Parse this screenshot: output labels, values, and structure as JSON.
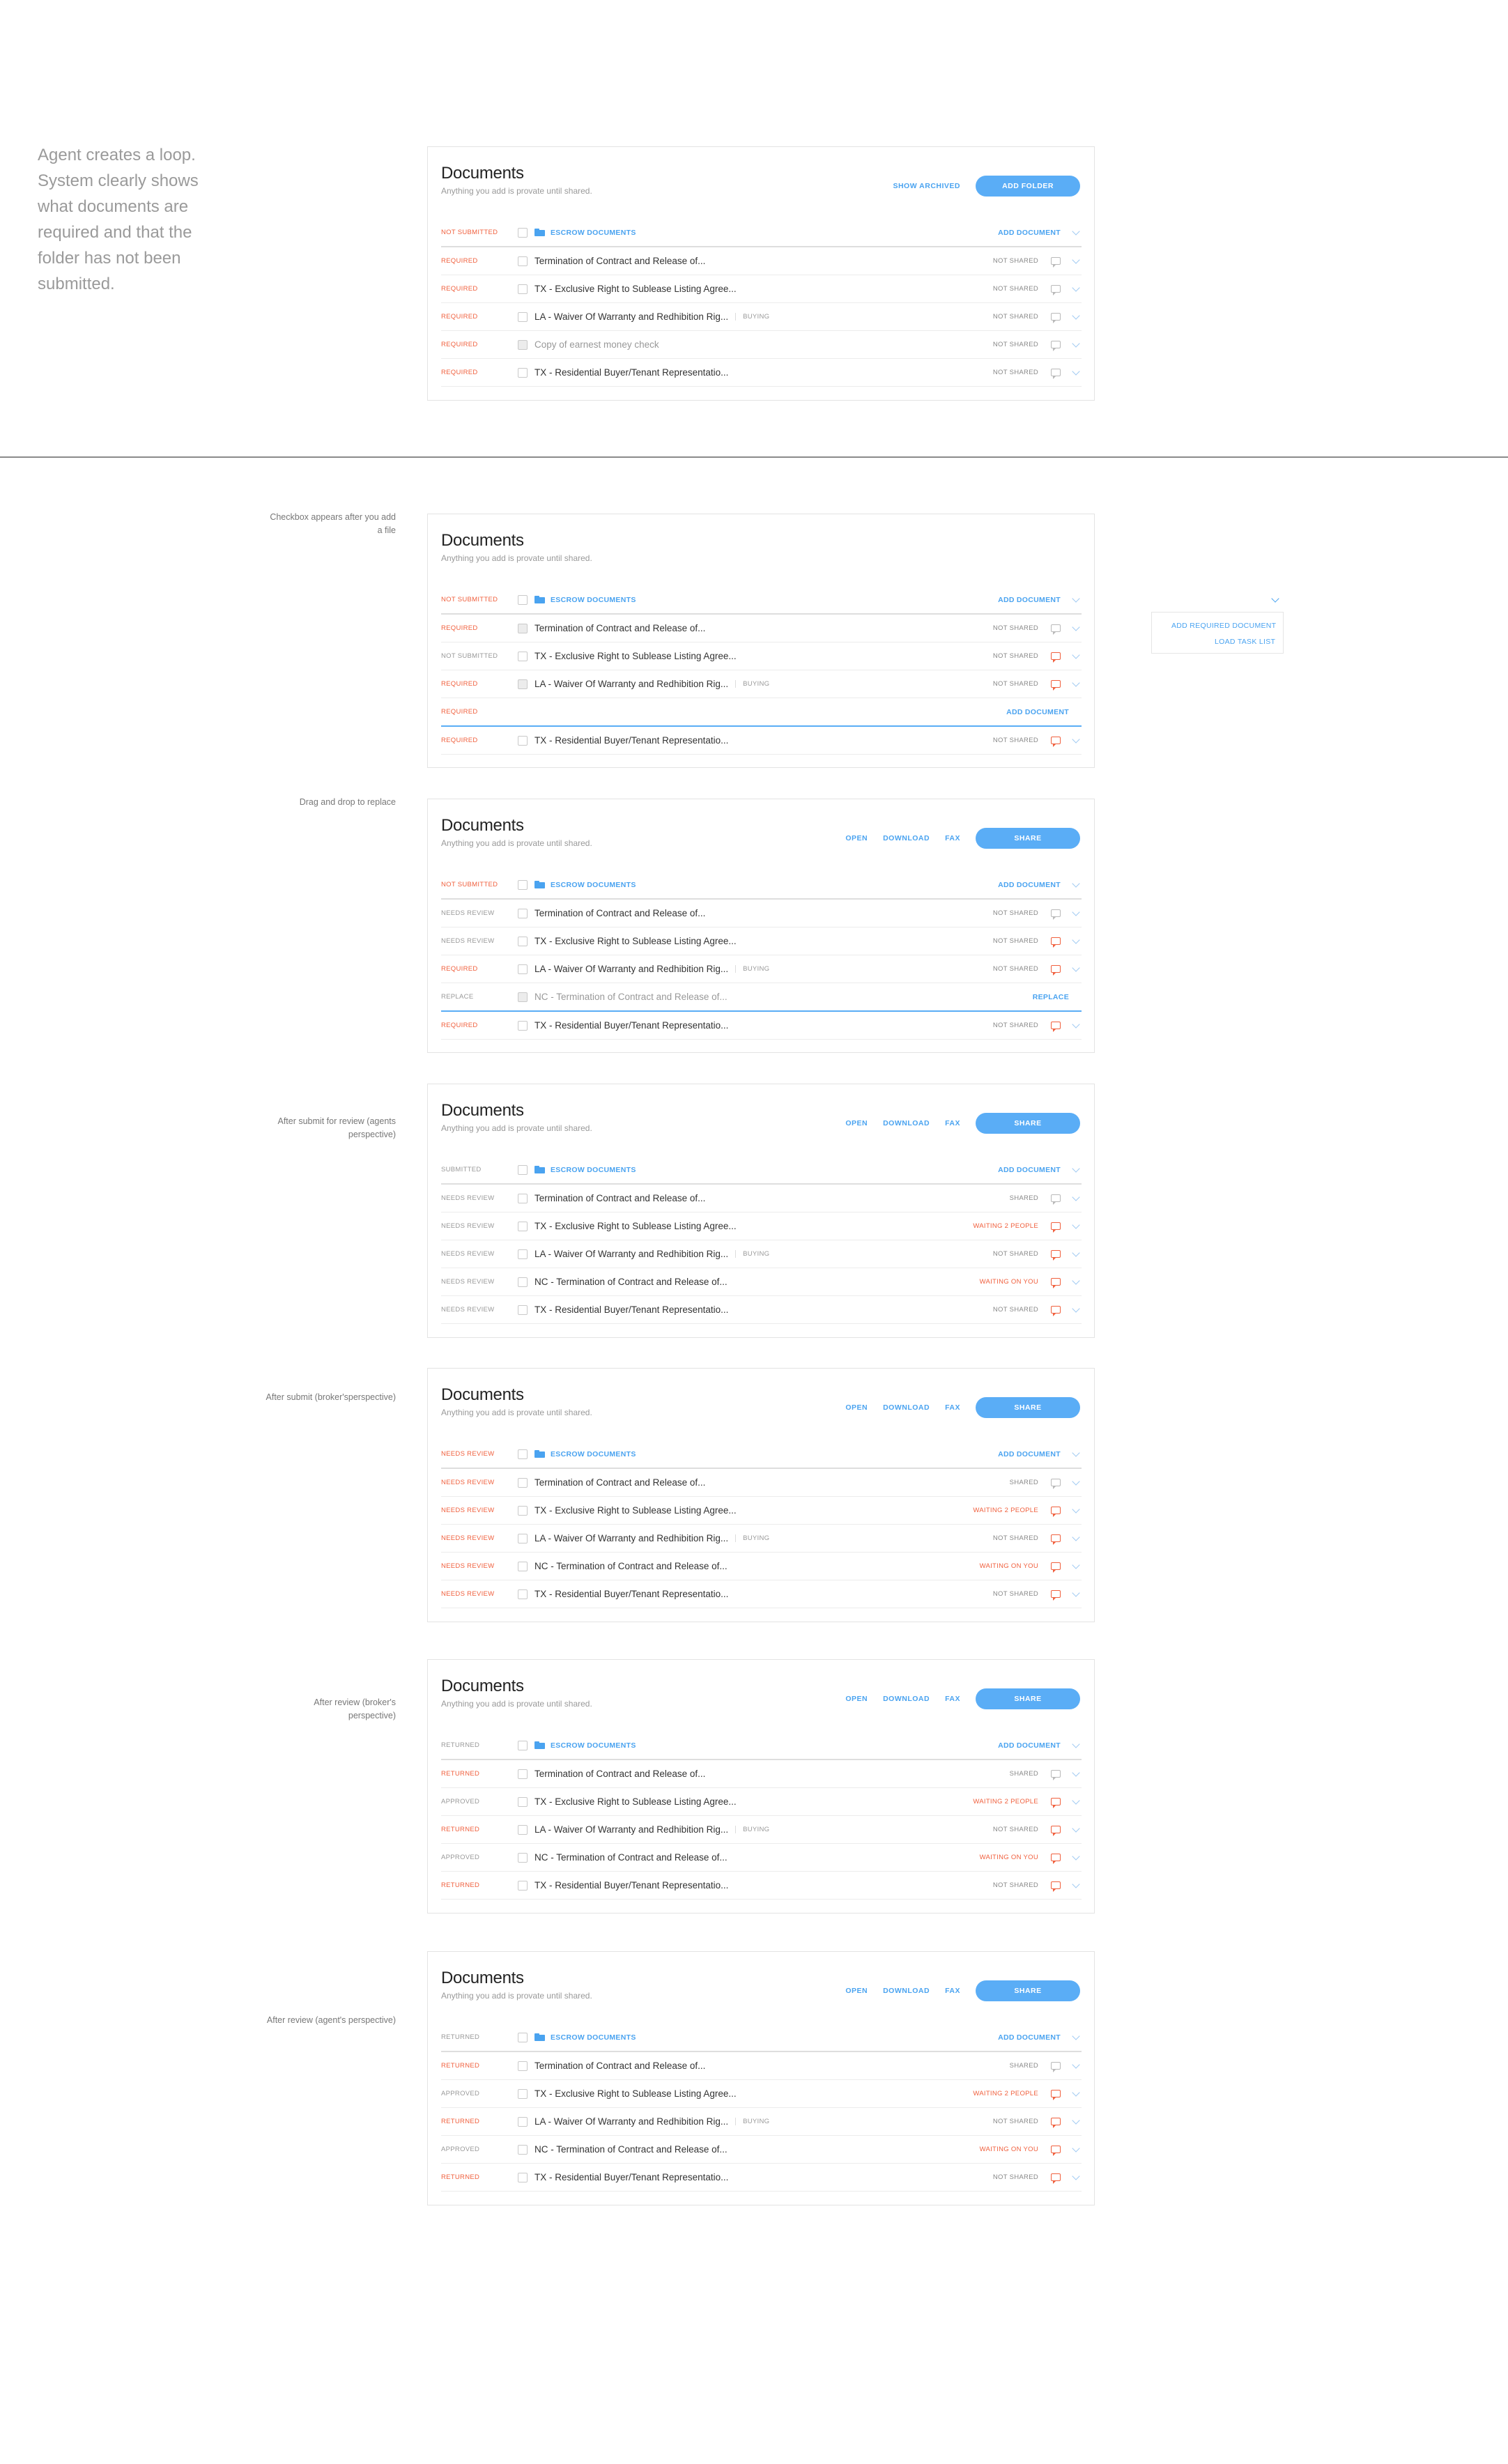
{
  "intro": "Agent creates a loop. System clearly shows what documents are required and that the folder has not been submitted.",
  "popup": {
    "items": [
      "ADD REQUIRED DOCUMENT",
      "LOAD TASK LIST"
    ]
  },
  "sections": [
    {
      "label": "",
      "title": "Documents",
      "subtitle": "Anything you add is provate until shared.",
      "actions": {
        "links": [
          "SHOW ARCHIVED"
        ],
        "button": "ADD FOLDER"
      },
      "folder": {
        "status": "NOT SUBMITTED",
        "name": "ESCROW DOCUMENTS",
        "action": "ADD DOCUMENT"
      },
      "rows": [
        {
          "status": "REQUIRED",
          "name": "Termination of Contract and Release of...",
          "share": "NOT SHARED"
        },
        {
          "status": "REQUIRED",
          "name": "TX - Exclusive Right to Sublease Listing Agree...",
          "share": "NOT SHARED"
        },
        {
          "status": "REQUIRED",
          "name": "LA - Waiver Of Warranty and Redhibition Rig...",
          "tag": "BUYING",
          "share": "NOT SHARED"
        },
        {
          "status": "REQUIRED",
          "name": "Copy of earnest money check",
          "share": "NOT SHARED"
        },
        {
          "status": "REQUIRED",
          "name": "TX - Residential Buyer/Tenant Representatio...",
          "share": "NOT SHARED"
        }
      ]
    },
    {
      "label": "Checkbox appears after you add a file",
      "title": "Documents",
      "subtitle": "Anything you add is provate until shared.",
      "actions": {
        "links": [],
        "button": ""
      },
      "folder": {
        "status": "NOT SUBMITTED",
        "name": "ESCROW DOCUMENTS",
        "action": "ADD DOCUMENT"
      },
      "rows": [
        {
          "status": "REQUIRED",
          "name": "Termination of Contract and Release of...",
          "share": "NOT SHARED"
        },
        {
          "status": "NOT SUBMITTED",
          "name": "TX - Exclusive Right to Sublease Listing Agree...",
          "share": "NOT SHARED"
        },
        {
          "status": "REQUIRED",
          "name": "LA - Waiver Of Warranty and Redhibition Rig...",
          "tag": "BUYING",
          "share": "NOT SHARED"
        },
        {
          "status": "REQUIRED",
          "name": "",
          "link": "ADD DOCUMENT"
        },
        {
          "status": "REQUIRED",
          "name": "TX - Residential Buyer/Tenant Representatio...",
          "share": "NOT SHARED"
        }
      ]
    },
    {
      "label": "Drag and drop to replace",
      "title": "Documents",
      "subtitle": "Anything you add is provate until shared.",
      "actions": {
        "links": [
          "OPEN",
          "DOWNLOAD",
          "FAX"
        ],
        "button": "SHARE"
      },
      "folder": {
        "status": "NOT SUBMITTED",
        "name": "ESCROW DOCUMENTS",
        "action": "ADD DOCUMENT"
      },
      "rows": [
        {
          "status": "NEEDS REVIEW",
          "name": "Termination of Contract and Release of...",
          "share": "NOT SHARED"
        },
        {
          "status": "NEEDS REVIEW",
          "name": "TX - Exclusive Right to Sublease Listing Agree...",
          "share": "NOT SHARED"
        },
        {
          "status": "REQUIRED",
          "name": "LA - Waiver Of Warranty and Redhibition Rig...",
          "tag": "BUYING",
          "share": "NOT SHARED"
        },
        {
          "status": "REPLACE",
          "name": "NC - Termination of Contract and Release of...",
          "link": "REPLACE"
        },
        {
          "status": "REQUIRED",
          "name": "TX - Residential Buyer/Tenant Representatio...",
          "share": "NOT SHARED"
        }
      ]
    },
    {
      "label": "After submit for review (agents perspective)",
      "title": "Documents",
      "subtitle": "Anything you add is provate until shared.",
      "actions": {
        "links": [
          "OPEN",
          "DOWNLOAD",
          "FAX"
        ],
        "button": "SHARE"
      },
      "folder": {
        "status": "SUBMITTED",
        "name": "ESCROW DOCUMENTS",
        "action": "ADD DOCUMENT"
      },
      "rows": [
        {
          "status": "NEEDS REVIEW",
          "name": "Termination of Contract and Release of...",
          "share": "SHARED"
        },
        {
          "status": "NEEDS REVIEW",
          "name": "TX - Exclusive Right to Sublease Listing Agree...",
          "share": "WAITING 2 PEOPLE"
        },
        {
          "status": "NEEDS REVIEW",
          "name": "LA - Waiver Of Warranty and Redhibition Rig...",
          "tag": "BUYING",
          "share": "NOT SHARED"
        },
        {
          "status": "NEEDS REVIEW",
          "name": "NC - Termination of Contract and Release of...",
          "share": "WAITING ON YOU"
        },
        {
          "status": "NEEDS REVIEW",
          "name": "TX - Residential Buyer/Tenant Representatio...",
          "share": "NOT SHARED"
        }
      ]
    },
    {
      "label": "After submit (broker'sperspective)",
      "title": "Documents",
      "subtitle": "Anything you add is provate until shared.",
      "actions": {
        "links": [
          "OPEN",
          "DOWNLOAD",
          "FAX"
        ],
        "button": "SHARE"
      },
      "folder": {
        "status": "NEEDS REVIEW",
        "name": "ESCROW DOCUMENTS",
        "action": "ADD DOCUMENT"
      },
      "rows": [
        {
          "status": "NEEDS REVIEW",
          "name": "Termination of Contract and Release of...",
          "share": "SHARED"
        },
        {
          "status": "NEEDS REVIEW",
          "name": "TX - Exclusive Right to Sublease Listing Agree...",
          "share": "WAITING 2 PEOPLE"
        },
        {
          "status": "NEEDS REVIEW",
          "name": "LA - Waiver Of Warranty and Redhibition Rig...",
          "tag": "BUYING",
          "share": "NOT SHARED"
        },
        {
          "status": "NEEDS REVIEW",
          "name": "NC - Termination of Contract and Release of...",
          "share": "WAITING ON YOU"
        },
        {
          "status": "NEEDS REVIEW",
          "name": "TX - Residential Buyer/Tenant Representatio...",
          "share": "NOT SHARED"
        }
      ]
    },
    {
      "label": "After review (broker's perspective)",
      "title": "Documents",
      "subtitle": "Anything you add is provate until shared.",
      "actions": {
        "links": [
          "OPEN",
          "DOWNLOAD",
          "FAX"
        ],
        "button": "SHARE"
      },
      "folder": {
        "status": "RETURNED",
        "name": "ESCROW DOCUMENTS",
        "action": "ADD DOCUMENT"
      },
      "rows": [
        {
          "status": "RETURNED",
          "name": "Termination of Contract and Release of...",
          "share": "SHARED"
        },
        {
          "status": "APPROVED",
          "name": "TX - Exclusive Right to Sublease Listing Agree...",
          "share": "WAITING 2 PEOPLE"
        },
        {
          "status": "RETURNED",
          "name": "LA - Waiver Of Warranty and Redhibition Rig...",
          "tag": "BUYING",
          "share": "NOT SHARED"
        },
        {
          "status": "APPROVED",
          "name": "NC - Termination of Contract and Release of...",
          "share": "WAITING ON YOU"
        },
        {
          "status": "RETURNED",
          "name": "TX - Residential Buyer/Tenant Representatio...",
          "share": "NOT SHARED"
        }
      ]
    },
    {
      "label": "After review (agent's perspective)",
      "title": "Documents",
      "subtitle": "Anything you add is provate until shared.",
      "actions": {
        "links": [
          "OPEN",
          "DOWNLOAD",
          "FAX"
        ],
        "button": "SHARE"
      },
      "folder": {
        "status": "RETURNED",
        "name": "ESCROW DOCUMENTS",
        "action": "ADD DOCUMENT"
      },
      "rows": [
        {
          "status": "RETURNED",
          "name": "Termination of Contract and Release of...",
          "share": "SHARED"
        },
        {
          "status": "APPROVED",
          "name": "TX - Exclusive Right to Sublease Listing Agree...",
          "share": "WAITING 2 PEOPLE"
        },
        {
          "status": "RETURNED",
          "name": "LA - Waiver Of Warranty and Redhibition Rig...",
          "tag": "BUYING",
          "share": "NOT SHARED"
        },
        {
          "status": "APPROVED",
          "name": "NC - Termination of Contract and Release of...",
          "share": "WAITING ON YOU"
        },
        {
          "status": "RETURNED",
          "name": "TX - Residential Buyer/Tenant Representatio...",
          "share": "NOT SHARED"
        }
      ]
    }
  ]
}
